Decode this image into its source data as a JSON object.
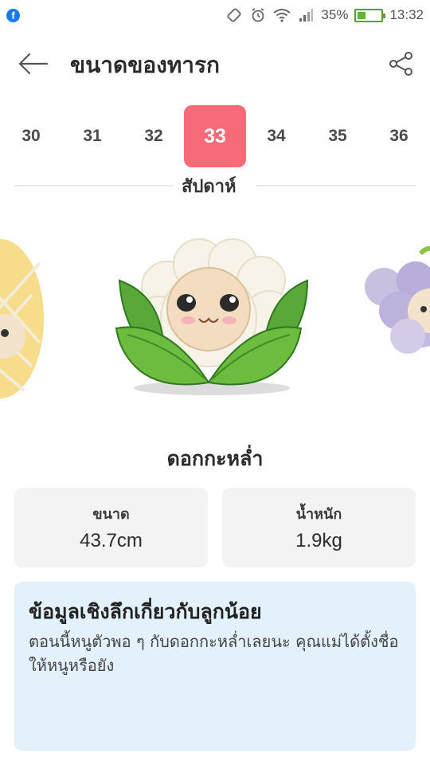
{
  "status_bar": {
    "app_badge": "f",
    "battery_percent": "35%",
    "battery_level": 0.35,
    "time": "13:32"
  },
  "header": {
    "title": "ขนาดของทารก"
  },
  "weeks": {
    "items": [
      "30",
      "31",
      "32",
      "33",
      "34",
      "35",
      "36"
    ],
    "selected": "33",
    "label": "สัปดาห์"
  },
  "fruit": {
    "name": "ดอกกะหล่ำ"
  },
  "stats": {
    "size_label": "ขนาด",
    "size_value": "43.7cm",
    "weight_label": "น้ำหนัก",
    "weight_value": "1.9kg"
  },
  "insight": {
    "title": "ข้อมูลเชิงลึกเกี่ยวกับลูกน้อย",
    "body": "ตอนนี้หนูตัวพอ ๆ กับดอกกะหล่ำเลยนะ คุณแม่ได้ตั้งชื่อให้หนูหรือยัง"
  },
  "colors": {
    "accent": "#f76b78",
    "card_bg": "#f3f3f4",
    "insight_bg": "#e3f1fc"
  }
}
